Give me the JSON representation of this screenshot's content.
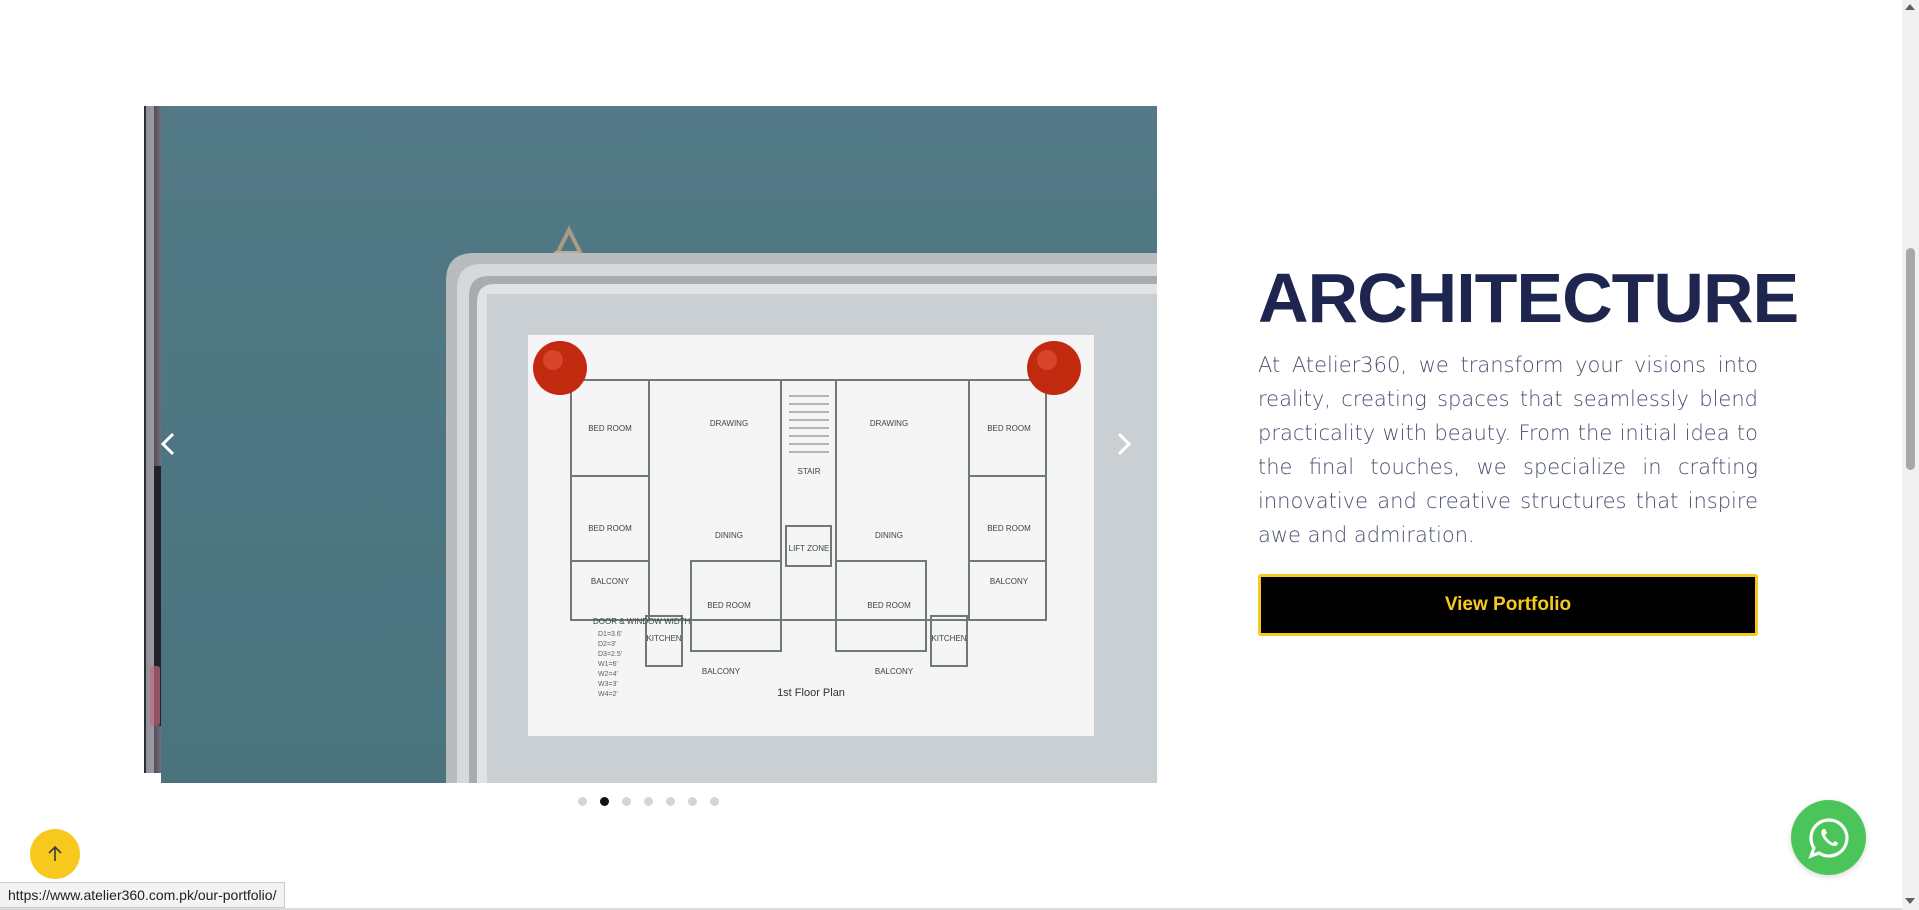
{
  "section": {
    "title": "ARCHITECTURE",
    "description": "At Atelier360, we transform your visions into reality, creating spaces that seamlessly blend practicality with beauty. From the initial idea to the final touches, we specialize in crafting innovative and creative structures that inspire awe and admiration.",
    "cta_label": "View Portfolio"
  },
  "carousel": {
    "slide_count": 7,
    "active_index": 1,
    "floor_plan": {
      "caption": "1st Floor Plan",
      "rooms": [
        "BED ROOM",
        "DRAWING",
        "STAIR",
        "DRAWING",
        "BED ROOM",
        "BED ROOM",
        "DINING",
        "LIFT ZONE",
        "DINING",
        "BED ROOM",
        "BED ROOM",
        "BED ROOM",
        "KITCHEN",
        "KITCHEN",
        "BALCONY",
        "BALCONY",
        "BALCONY",
        "BALCONY"
      ],
      "legend_title": "DOOR & WINDOW WIDTH"
    }
  },
  "status_bar": {
    "url": "https://www.atelier360.com.pk/our-portfolio/"
  },
  "colors": {
    "title": "#1e2650",
    "accent_yellow": "#f7c81e",
    "whatsapp_green": "#4bc55a",
    "wall_teal": "#4c7681"
  },
  "icons": {
    "prev": "chevron-left-icon",
    "next": "chevron-right-icon",
    "scroll_top": "arrow-up-icon",
    "whatsapp": "whatsapp-icon"
  }
}
